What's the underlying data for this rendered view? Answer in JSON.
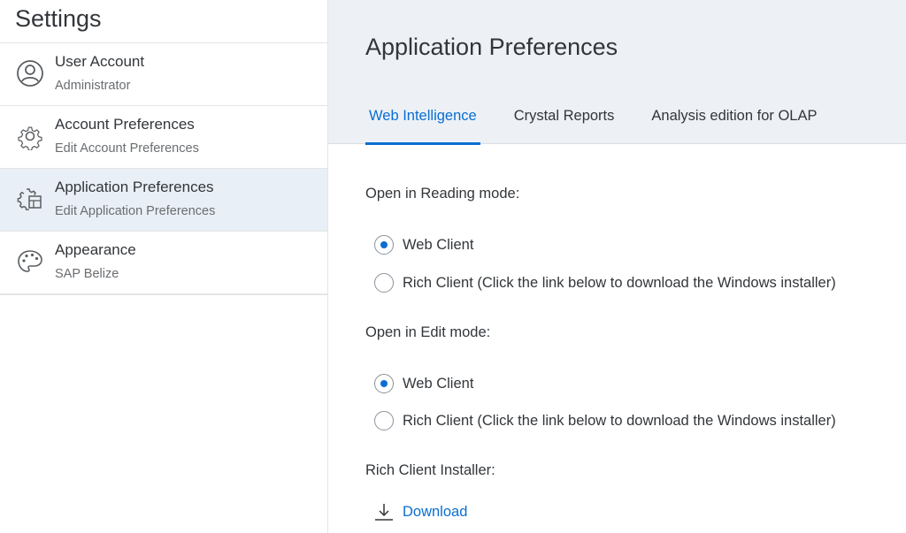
{
  "sidebar": {
    "title": "Settings",
    "items": [
      {
        "label": "User Account",
        "sublabel": "Administrator",
        "icon": "user-account-icon",
        "selected": false
      },
      {
        "label": "Account Preferences",
        "sublabel": "Edit Account Preferences",
        "icon": "gear-icon",
        "selected": false
      },
      {
        "label": "Application Preferences",
        "sublabel": "Edit Application Preferences",
        "icon": "application-preferences-icon",
        "selected": true
      },
      {
        "label": "Appearance",
        "sublabel": "SAP Belize",
        "icon": "palette-icon",
        "selected": false
      }
    ]
  },
  "main": {
    "title": "Application Preferences",
    "tabs": [
      {
        "label": "Web Intelligence",
        "active": true
      },
      {
        "label": "Crystal Reports",
        "active": false
      },
      {
        "label": "Analysis edition for OLAP",
        "active": false
      }
    ],
    "reading_mode": {
      "label": "Open in Reading mode:",
      "options": [
        {
          "label": "Web Client",
          "checked": true
        },
        {
          "label": "Rich Client (Click the link below to download the Windows installer)",
          "checked": false
        }
      ]
    },
    "edit_mode": {
      "label": "Open in Edit mode:",
      "options": [
        {
          "label": "Web Client",
          "checked": true
        },
        {
          "label": "Rich Client (Click the link below to download the Windows installer)",
          "checked": false
        }
      ]
    },
    "installer": {
      "label": "Rich Client Installer:",
      "download_label": "Download",
      "icon": "download-icon"
    }
  },
  "colors": {
    "accent": "#0a6ed1",
    "header_bg": "#edf1f5",
    "selected_bg": "#e8eff6",
    "text": "#32363a",
    "subtext": "#6a6d70"
  }
}
